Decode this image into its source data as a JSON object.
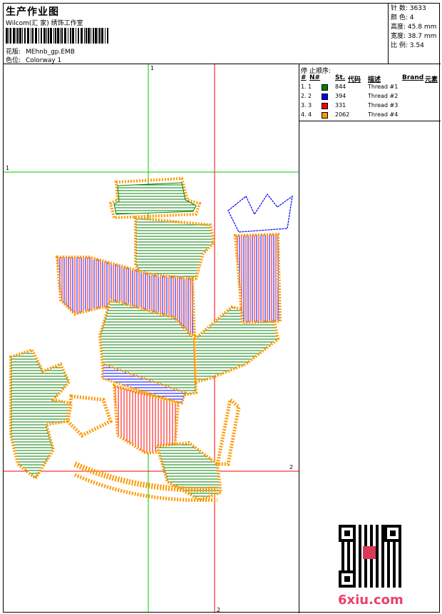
{
  "header": {
    "title": "生产作业图",
    "company": "Wilcom(汇 家) 绣饰工作室",
    "design_label": "花版:",
    "design_value": "MEhnb_gp.EMB",
    "color_label": "色位:",
    "color_value": "Colorway 1"
  },
  "stats": [
    {
      "label": "针 数:",
      "value": "3633"
    },
    {
      "label": "颜 色:",
      "value": "4"
    },
    {
      "label": "高度:",
      "value": "45.8 mm"
    },
    {
      "label": "宽度:",
      "value": "38.7 mm"
    },
    {
      "label": "比 例:",
      "value": "3.54"
    }
  ],
  "threads": {
    "title": "停 止顺序:",
    "headers": {
      "num": "#",
      "n": "N#",
      "st": "St.",
      "code": "代码",
      "desc": "描述",
      "brand": "Brand",
      "elem": "元素"
    },
    "rows": [
      {
        "num": "1.",
        "n": "1",
        "stitches": "844",
        "color": "#008000",
        "desc": "Thread #1"
      },
      {
        "num": "2.",
        "n": "2",
        "stitches": "394",
        "color": "#0000ff",
        "desc": "Thread #2"
      },
      {
        "num": "3.",
        "n": "3",
        "stitches": "331",
        "color": "#ff0000",
        "desc": "Thread #3"
      },
      {
        "num": "4.",
        "n": "4",
        "stitches": "2062",
        "color": "#ff9900",
        "desc": "Thread #4"
      }
    ]
  },
  "guides": {
    "top_label": "1",
    "left_label": "1",
    "right_label": "2",
    "bottom_label": "2"
  },
  "watermark": "6xiu.com",
  "colors": {
    "green": "#008000",
    "blue": "#0000ff",
    "red": "#ff0000",
    "orange": "#ff9900",
    "guide_green": "#00cc00",
    "guide_red": "#ff0000"
  }
}
